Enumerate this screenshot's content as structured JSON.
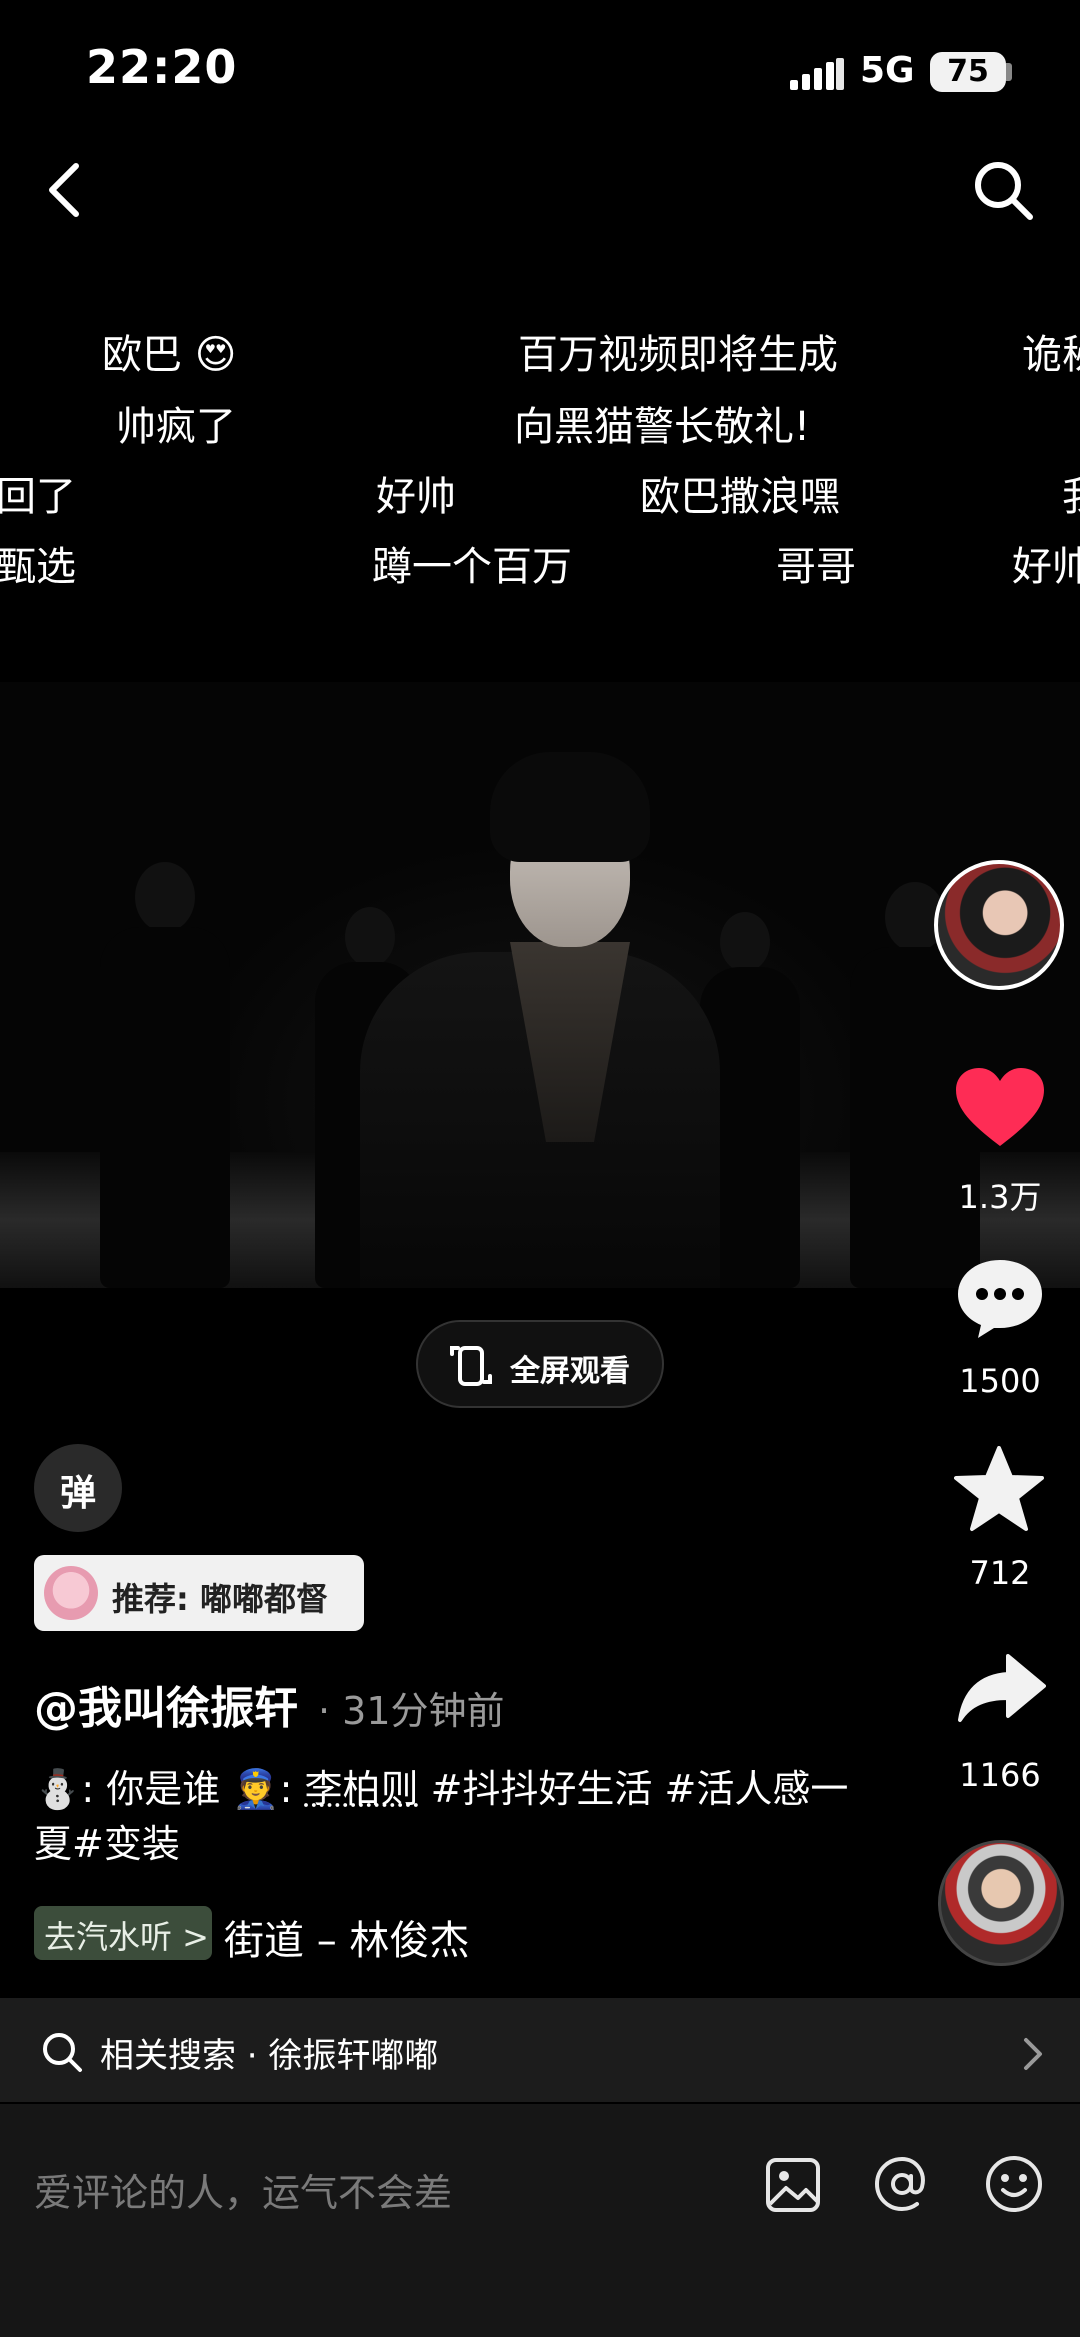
{
  "status": {
    "time": "22:20",
    "network": "5G",
    "battery": "75"
  },
  "danmaku": [
    "欧巴",
    "百万视频即将生成",
    "诡秘",
    "帅疯了",
    "向黑猫警长敬礼!",
    "回了",
    "好帅",
    "欧巴撒浪嘿",
    "我",
    "甄选",
    "蹲一个百万",
    "哥哥",
    "好帅"
  ],
  "video": {
    "fullscreen_label": "全屏观看"
  },
  "actions": {
    "likes": "1.3万",
    "comments": "1500",
    "favorites": "712",
    "shares": "1166"
  },
  "danmaku_toggle": "弹",
  "recommend": "推荐: 嘟嘟都督",
  "author": "@我叫徐振轩",
  "time_ago": "· 31分钟前",
  "description": {
    "part1": "⛄: 你是谁  👮: ",
    "mention": "李柏则",
    "tags": " #抖抖好生活 #活人感一夏#变装"
  },
  "music": {
    "tag": "去汽水听 >",
    "name": "街道 – 林俊杰"
  },
  "related_search": "相关搜索 · 徐振轩嘟嘟",
  "comment_placeholder": "爱评论的人，运气不会差",
  "colors": {
    "like": "#fe2c55",
    "background": "#000000"
  }
}
